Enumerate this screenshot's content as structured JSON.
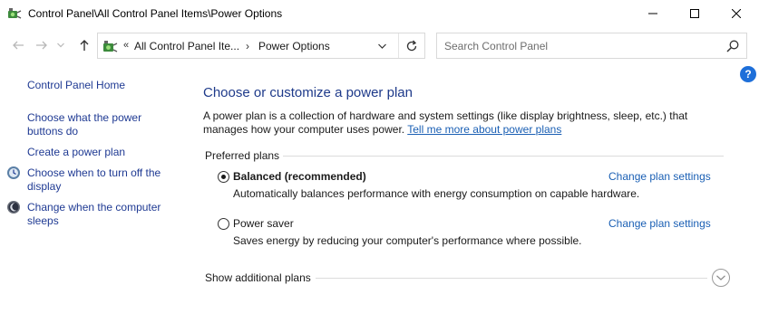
{
  "window": {
    "title": "Control Panel\\All Control Panel Items\\Power Options",
    "controls": {
      "minimize": "minimize",
      "maximize": "maximize",
      "close": "close"
    }
  },
  "navbar": {
    "chevrons": "«",
    "breadcrumb": [
      "All Control Panel Ite...",
      "Power Options"
    ],
    "separator": "›",
    "search_placeholder": "Search Control Panel",
    "search_value": ""
  },
  "help": {
    "label": "?"
  },
  "sidebar": {
    "home": "Control Panel Home",
    "links": [
      {
        "label": "Choose what the power buttons do",
        "icon": null
      },
      {
        "label": "Create a power plan",
        "icon": null
      },
      {
        "label": "Choose when to turn off the display",
        "icon": "monitor-clock-icon"
      },
      {
        "label": "Change when the computer sleeps",
        "icon": "moon-sleep-icon"
      }
    ]
  },
  "main": {
    "title": "Choose or customize a power plan",
    "description": "A power plan is a collection of hardware and system settings (like display brightness, sleep, etc.) that manages how your computer uses power.",
    "learn_more": "Tell me more about power plans",
    "preferred_label": "Preferred plans",
    "plans": [
      {
        "name": "Balanced (recommended)",
        "selected": true,
        "change": "Change plan settings",
        "description": "Automatically balances performance with energy consumption on capable hardware."
      },
      {
        "name": "Power saver",
        "selected": false,
        "change": "Change plan settings",
        "description": "Saves energy by reducing your computer's performance where possible."
      }
    ],
    "additional_label": "Show additional plans"
  },
  "colors": {
    "link": "#1f3a93",
    "title": "#1e3a8a",
    "help": "#1e6fd9"
  }
}
